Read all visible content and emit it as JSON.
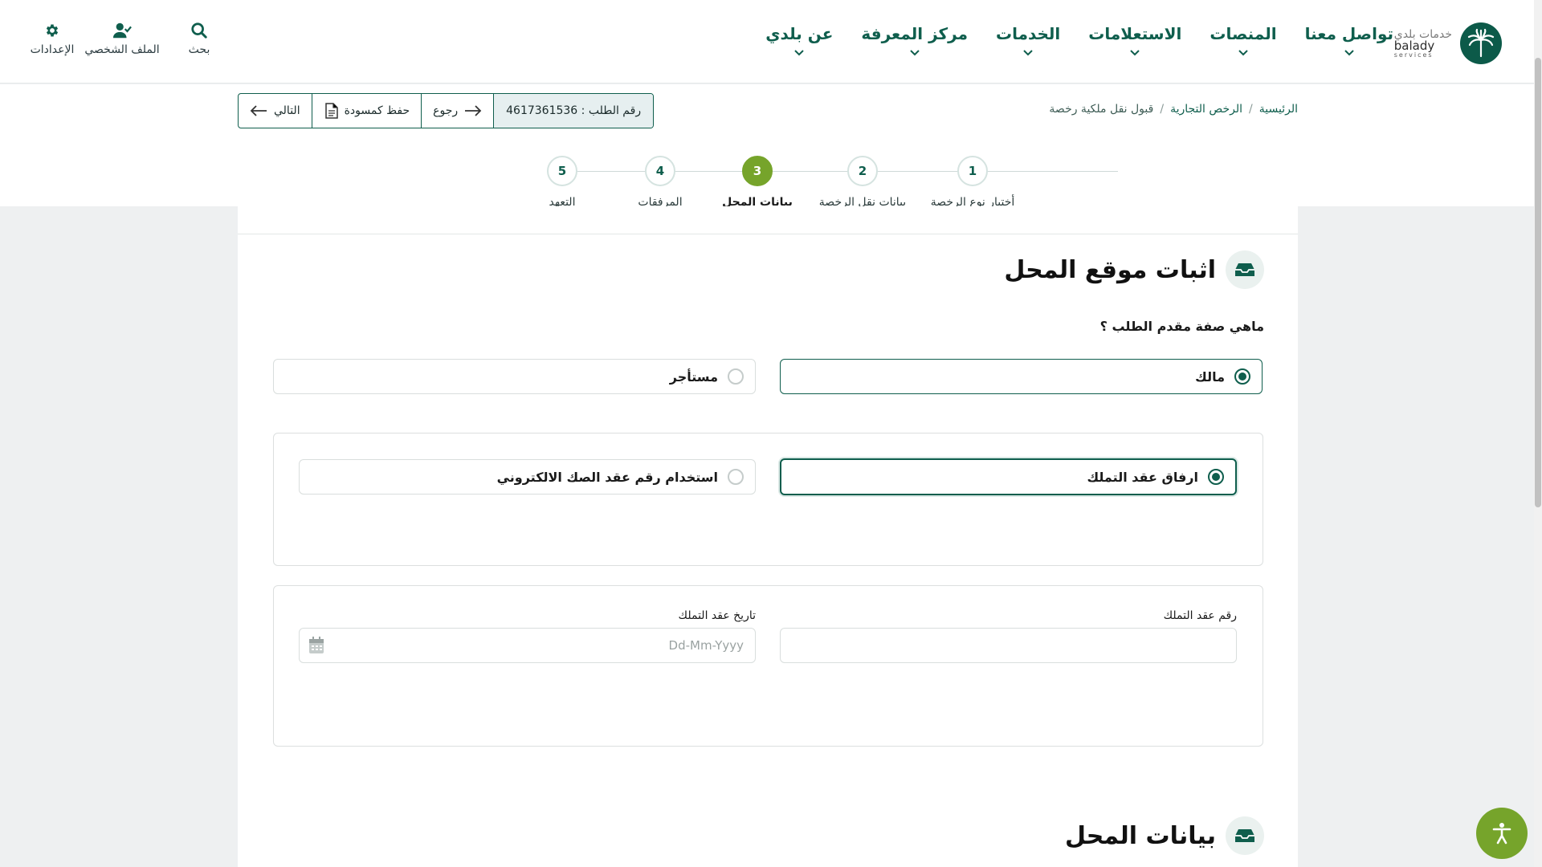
{
  "header": {
    "utilities": [
      {
        "label": "بحث",
        "icon": "search-icon"
      },
      {
        "label": "الملف الشخصي",
        "icon": "user-check-icon"
      },
      {
        "label": "الإعدادات",
        "icon": "gear-icon"
      }
    ],
    "nav": [
      {
        "label": "عن بلدي"
      },
      {
        "label": "مركز المعرفة"
      },
      {
        "label": "الخدمات"
      },
      {
        "label": "الاستعلامات"
      },
      {
        "label": "المنصات"
      },
      {
        "label": "تواصل معنا"
      }
    ],
    "logo": {
      "arabic": "خدمات بلدي",
      "english": "balady",
      "sub": "services",
      "icon": "palm-emblem-icon"
    }
  },
  "breadcrumb": [
    "الرئيسية",
    "الرخص التجارية",
    "قبول نقل ملكية رخصة"
  ],
  "actions": {
    "request_number": "رقم الطلب : 4617361536",
    "back": "رجوع",
    "save_draft": "حفظ كمسودة",
    "next": "التالي"
  },
  "steps": [
    {
      "number": "1",
      "label": "أختيار نوع الرخصة"
    },
    {
      "number": "2",
      "label": "بيانات نقل الرخصة"
    },
    {
      "number": "3",
      "label": "بيانات المحل",
      "active": true
    },
    {
      "number": "4",
      "label": "المرفقات"
    },
    {
      "number": "5",
      "label": "التعهد"
    }
  ],
  "section1": {
    "title": "اثبات موقع المحل",
    "question": "ماهي صفة مقدم الطلب ؟",
    "applicant_options": [
      {
        "label": "مالك",
        "selected": true
      },
      {
        "label": "مستأجر",
        "selected": false
      }
    ],
    "proof_options": [
      {
        "label": "ارفاق عقد التملك",
        "selected": true
      },
      {
        "label": "استخدام رقم عقد الصك الالكتروني",
        "selected": false
      }
    ],
    "fields": {
      "contract_number_label": "رقم عقد التملك",
      "contract_number_value": "",
      "contract_date_label": "تاريخ عقد التملك",
      "contract_date_placeholder": "Dd-Mm-Yyyy"
    }
  },
  "section2": {
    "title": "بيانات المحل"
  },
  "colors": {
    "brand": "#0f5e4d",
    "accent": "#76a42b",
    "page_bg": "#eef0f1"
  }
}
